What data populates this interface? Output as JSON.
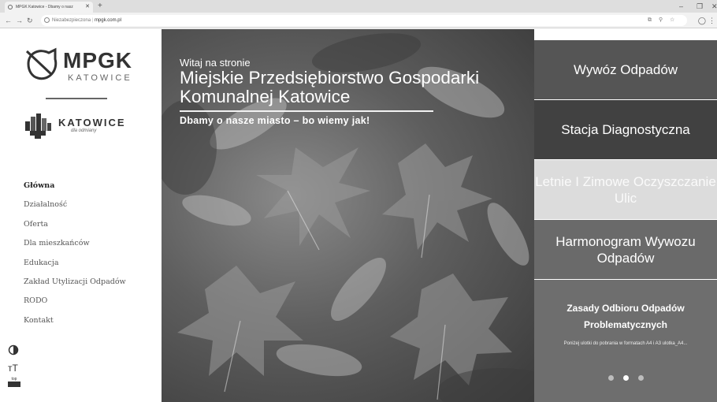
{
  "browser": {
    "tab_title": "MPGK Katowice - Dbamy o nasz",
    "new_tab": "+",
    "security_label": "Niezabezpieczona",
    "url": "mpgk.com.pl"
  },
  "sidebar": {
    "logo": {
      "name": "MPGK",
      "sub": "KATOWICE"
    },
    "city_logo": {
      "name": "KATOWICE",
      "tagline": "dla odmiany"
    },
    "nav": [
      {
        "label": "Główna",
        "active": true
      },
      {
        "label": "Działalność"
      },
      {
        "label": "Oferta"
      },
      {
        "label": "Dla mieszkańców"
      },
      {
        "label": "Edukacja"
      },
      {
        "label": "Zakład Utylizacji Odpadów"
      },
      {
        "label": "RODO"
      },
      {
        "label": "Kontakt"
      }
    ],
    "tools": {
      "font_size_symbol": "тT",
      "top_label": "top"
    }
  },
  "hero": {
    "welcome": "Witaj na stronie",
    "title": "Miejskie Przedsiębiorstwo Gospodarki Komunalnej Katowice",
    "slogan": "Dbamy o nasze miasto – bo wiemy jak!"
  },
  "tiles": [
    {
      "label": "Wywóz Odpadów"
    },
    {
      "label": "Stacja Diagnostyczna"
    },
    {
      "label": "Letnie I Zimowe Oczyszczanie Ulic"
    },
    {
      "label": "Harmonogram Wywozu Odpadów"
    }
  ],
  "news": {
    "title": "Zasady Odbioru Odpadów Problematycznych",
    "description": "Poniżej ulotki do pobrania w formatach A4 i A3 ulotka_A4...",
    "slides": 3,
    "active_slide": 2
  }
}
